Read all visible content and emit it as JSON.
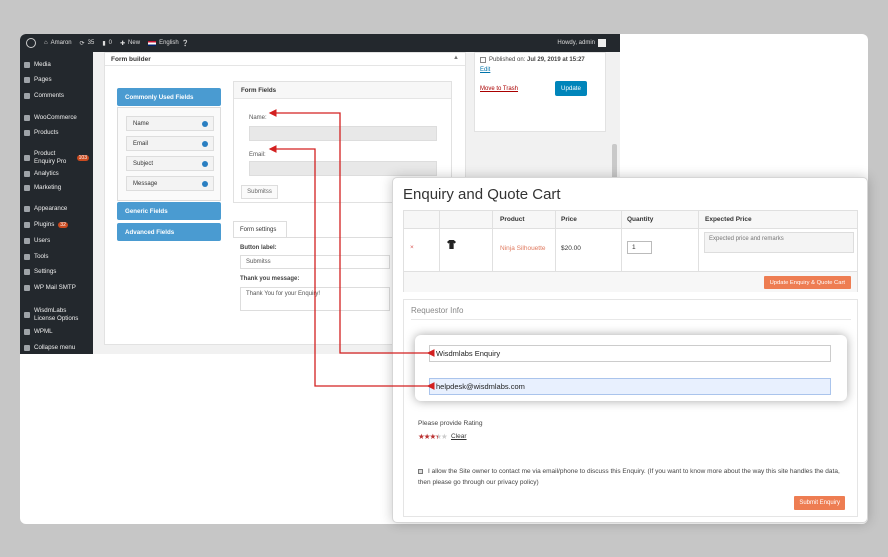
{
  "colors": {
    "wp_dark": "#23282d",
    "wp_blue": "#4a9bd1",
    "accent_orange": "#ee7d52",
    "arrow_red": "#d32020"
  },
  "adminbar": {
    "site": "Amaron",
    "updates": "35",
    "comments": "0",
    "new": "New",
    "language": "English",
    "howdy": "Howdy, admin"
  },
  "sidebar": {
    "items": [
      {
        "label": "Media",
        "icon": "media-icon"
      },
      {
        "label": "Pages",
        "icon": "pages-icon"
      },
      {
        "label": "Comments",
        "icon": "comments-icon"
      },
      {
        "label": "WooCommerce",
        "icon": "woocommerce-icon"
      },
      {
        "label": "Products",
        "icon": "products-icon"
      },
      {
        "label": "Product Enquiry Pro",
        "icon": "enquiry-icon",
        "badge": "103"
      },
      {
        "label": "Analytics",
        "icon": "analytics-icon"
      },
      {
        "label": "Marketing",
        "icon": "marketing-icon"
      },
      {
        "label": "Appearance",
        "icon": "appearance-icon"
      },
      {
        "label": "Plugins",
        "icon": "plugins-icon",
        "badge": "32"
      },
      {
        "label": "Users",
        "icon": "users-icon"
      },
      {
        "label": "Tools",
        "icon": "tools-icon"
      },
      {
        "label": "Settings",
        "icon": "settings-icon"
      },
      {
        "label": "WP Mail SMTP",
        "icon": "mail-icon"
      },
      {
        "label": "WisdmLabs License Options",
        "icon": "license-icon"
      },
      {
        "label": "WPML",
        "icon": "wpml-icon"
      },
      {
        "label": "Collapse menu",
        "icon": "collapse-icon"
      }
    ]
  },
  "form_builder": {
    "title": "Form builder",
    "commonly_used": "Commonly Used Fields",
    "fields": [
      "Name",
      "Email",
      "Subject",
      "Message"
    ],
    "generic": "Generic Fields",
    "advanced": "Advanced Fields",
    "form_fields_title": "Form Fields",
    "name_label": "Name:",
    "email_label": "Email:",
    "submit_btn": "Submitss",
    "settings_tab": "Form settings",
    "button_label": "Button label:",
    "button_value": "Submitss",
    "thanks_label": "Thank you message:",
    "thanks_value": "Thank You for your Enquiry!"
  },
  "publish": {
    "published_prefix": "Published on: ",
    "published_date": "Jul 29, 2019 at 15:27",
    "edit": "Edit",
    "trash": "Move to Trash",
    "update": "Update"
  },
  "cart": {
    "title": "Enquiry and Quote Cart",
    "headers": [
      "Product",
      "Price",
      "Quantity",
      "Expected Price"
    ],
    "row": {
      "remove": "×",
      "product": "Ninja Silhouette",
      "price": "$20.00",
      "quantity": "1",
      "expected_placeholder": "Expected price and remarks"
    },
    "update_btn": "Update Enquiry & Quote Cart"
  },
  "requestor": {
    "title": "Requestor Info",
    "name_value": "Wisdmlabs Enquiry",
    "email_value": "helpdesk@wisdmlabs.com",
    "rating_label": "Please provide Rating",
    "rating": 3.5,
    "rating_max": 5,
    "clear": "Clear",
    "consent": "I allow the Site owner to contact me via email/phone to discuss this Enquiry. (If you want to know more about the way this site handles the data, then please go through our privacy policy)",
    "submit": "Submit Enquiry"
  }
}
